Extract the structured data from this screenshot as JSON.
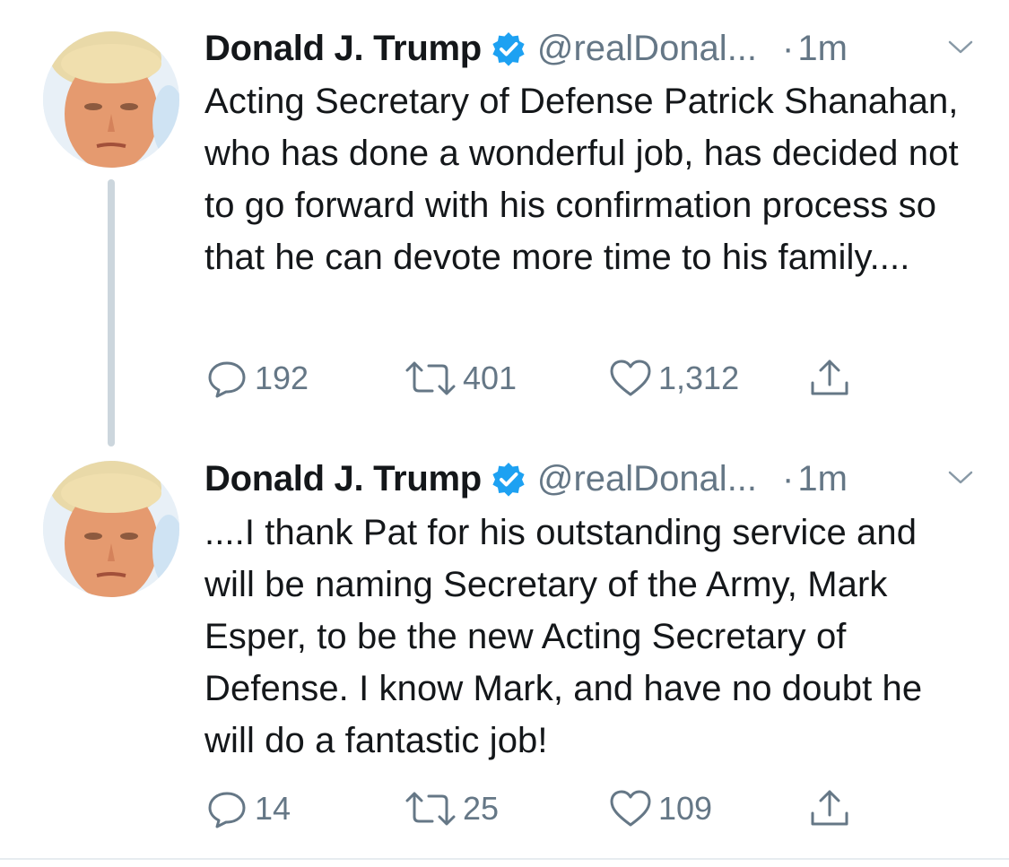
{
  "colors": {
    "text": "#14171a",
    "secondary": "#657786",
    "verified_blue": "#1da1f2",
    "thread_line": "#ccd6dd"
  },
  "tweets": [
    {
      "name": "Donald J. Trump",
      "handle": "@realDonal...",
      "dot": "·",
      "time": "1m",
      "text": "Acting Secretary of Defense Patrick Shanahan, who has done a wonderful job, has decided not to go forward with his confirmation process so that he can devote more time to his family....",
      "replies": "192",
      "retweets": "401",
      "likes": "1,312"
    },
    {
      "name": "Donald J. Trump",
      "handle": "@realDonal...",
      "dot": "·",
      "time": "1m",
      "text": "....I thank Pat for his outstanding service and will be naming Secretary of the Army, Mark Esper, to be the new Acting Secretary of Defense. I know Mark, and have no doubt he will do a fantastic job!",
      "replies": "14",
      "retweets": "25",
      "likes": "109"
    }
  ]
}
